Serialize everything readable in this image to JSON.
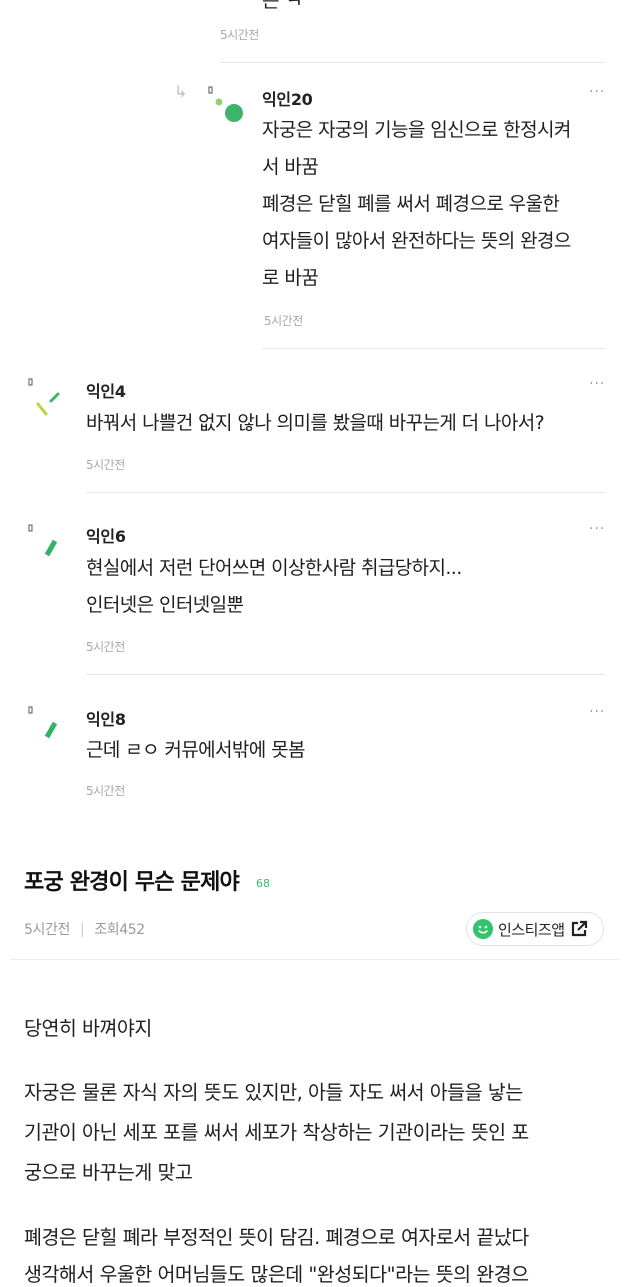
{
  "top_fragment": {
    "text": "는 ㅋ",
    "time": "5시간전"
  },
  "comments": [
    {
      "nick": "익인20",
      "is_reply": true,
      "more": "···",
      "lines": [
        "자궁은 자궁의 기능을 임신으로 한정시켜",
        "서 바꿈",
        "폐경은 닫힐 폐를 써서 폐경으로 우울한",
        "여자들이 많아서 완전하다는 뜻의 완경으",
        "로 바꿈"
      ],
      "time": "5시간전"
    },
    {
      "nick": "익인4",
      "more": "···",
      "lines": [
        "바꿔서 나쁠건 없지 않나 의미를 봤을때 바꾸는게 더 나아서?"
      ],
      "time": "5시간전"
    },
    {
      "nick": "익인6",
      "more": "···",
      "lines": [
        "현실에서 저런 단어쓰면 이상한사람 취급당하지...",
        "인터넷은 인터넷일뿐"
      ],
      "time": "5시간전"
    },
    {
      "nick": "익인8",
      "more": "···",
      "lines": [
        "근데 ㄹㅇ 커뮤에서밖에 못봄"
      ],
      "time": "5시간전"
    }
  ],
  "post": {
    "title": "포궁 완경이 무슨 문제야",
    "comment_count": "68",
    "time": "5시간전",
    "views": "조회452",
    "app_button": "인스티즈앱",
    "lines": [
      "당연히 바껴야지",
      "자궁은 물론 자식 자의 뜻도 있지만, 아들 자도 써서 아들을 낳는",
      "기관이 아닌 세포 포를 써서 세포가 착상하는 기관이라는 뜻인 포",
      "궁으로 바꾸는게 맞고",
      "폐경은 닫힐 폐라 부정적인 뜻이 담김. 폐경으로 여자로서 끝났다",
      "생각해서 우울한 어머님들도 많은데 \"완성되다\"라는 뜻의 완경으"
    ]
  },
  "colors": {
    "accent": "#3cba6f",
    "text": "#1f1f1f",
    "muted": "#a8a8a8"
  }
}
